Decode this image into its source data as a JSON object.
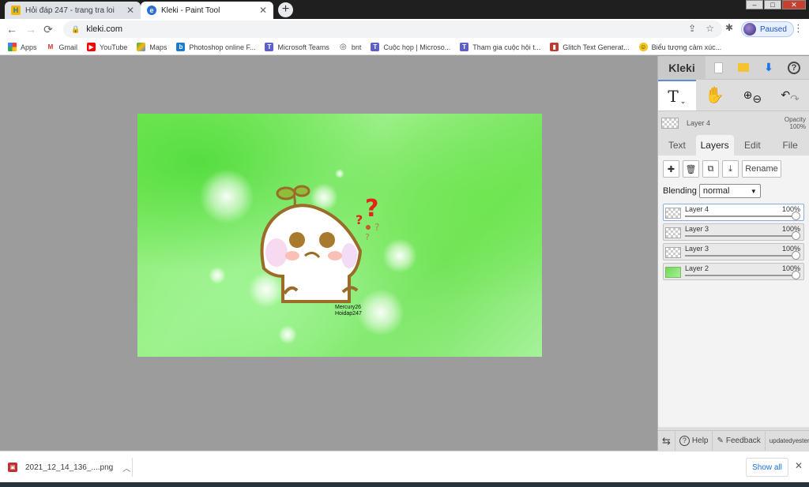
{
  "browser": {
    "tabs": [
      {
        "title": "Hỏi đáp 247 - trang tra loi",
        "active": false,
        "close": "✕"
      },
      {
        "title": "Kleki - Paint Tool",
        "active": true,
        "close": "✕"
      }
    ],
    "new_tab": "+",
    "url": "kleki.com",
    "profile_label": "Paused",
    "nav": {
      "back": "←",
      "forward": "→",
      "reload": "⟳"
    }
  },
  "bookmarks": [
    {
      "label": "Apps",
      "icon": "apps-grid-icon"
    },
    {
      "label": "Gmail",
      "icon": "gmail-icon"
    },
    {
      "label": "YouTube",
      "icon": "youtube-icon"
    },
    {
      "label": "Maps",
      "icon": "maps-icon"
    },
    {
      "label": "Photoshop online F...",
      "icon": "photoshop-icon"
    },
    {
      "label": "Microsoft Teams",
      "icon": "teams-icon"
    },
    {
      "label": "bnt",
      "icon": "globe-icon"
    },
    {
      "label": "Cuộc họp | Microso...",
      "icon": "teams-icon"
    },
    {
      "label": "Tham gia cuộc hội t...",
      "icon": "teams-icon"
    },
    {
      "label": "Glitch Text Generat...",
      "icon": "glitch-icon"
    },
    {
      "label": "Biểu tượng cảm xúc...",
      "icon": "emoji-icon"
    }
  ],
  "canvas": {
    "watermark_line1": "Mercury26",
    "watermark_line2": "Hoidap247"
  },
  "panel": {
    "logo": "Kleki",
    "current_layer_name": "Layer 4",
    "opacity_label": "Opacity",
    "opacity_value": "100%",
    "tabs": [
      "Text",
      "Layers",
      "Edit",
      "File"
    ],
    "active_tab": "Layers",
    "rename_label": "Rename",
    "blending_label": "Blending",
    "blending_value": "normal",
    "layers": [
      {
        "name": "Layer 4",
        "opacity": "100%",
        "selected": true
      },
      {
        "name": "Layer 3",
        "opacity": "100%",
        "selected": false
      },
      {
        "name": "Layer 3",
        "opacity": "100%",
        "selected": false
      },
      {
        "name": "Layer 2",
        "opacity": "100%",
        "selected": false
      }
    ],
    "footer": {
      "help": "Help",
      "feedback": "Feedback",
      "updated_line1": "updated",
      "updated_line2": "yesterday"
    }
  },
  "downloads": {
    "file_name": "2021_12_14_136_....png",
    "show_all": "Show all"
  },
  "colors": {
    "accent": "#1a73e8",
    "canvas_green": "#7fea5a",
    "workspace_gray": "#9c9c9c",
    "panel_gray": "#dedede"
  }
}
